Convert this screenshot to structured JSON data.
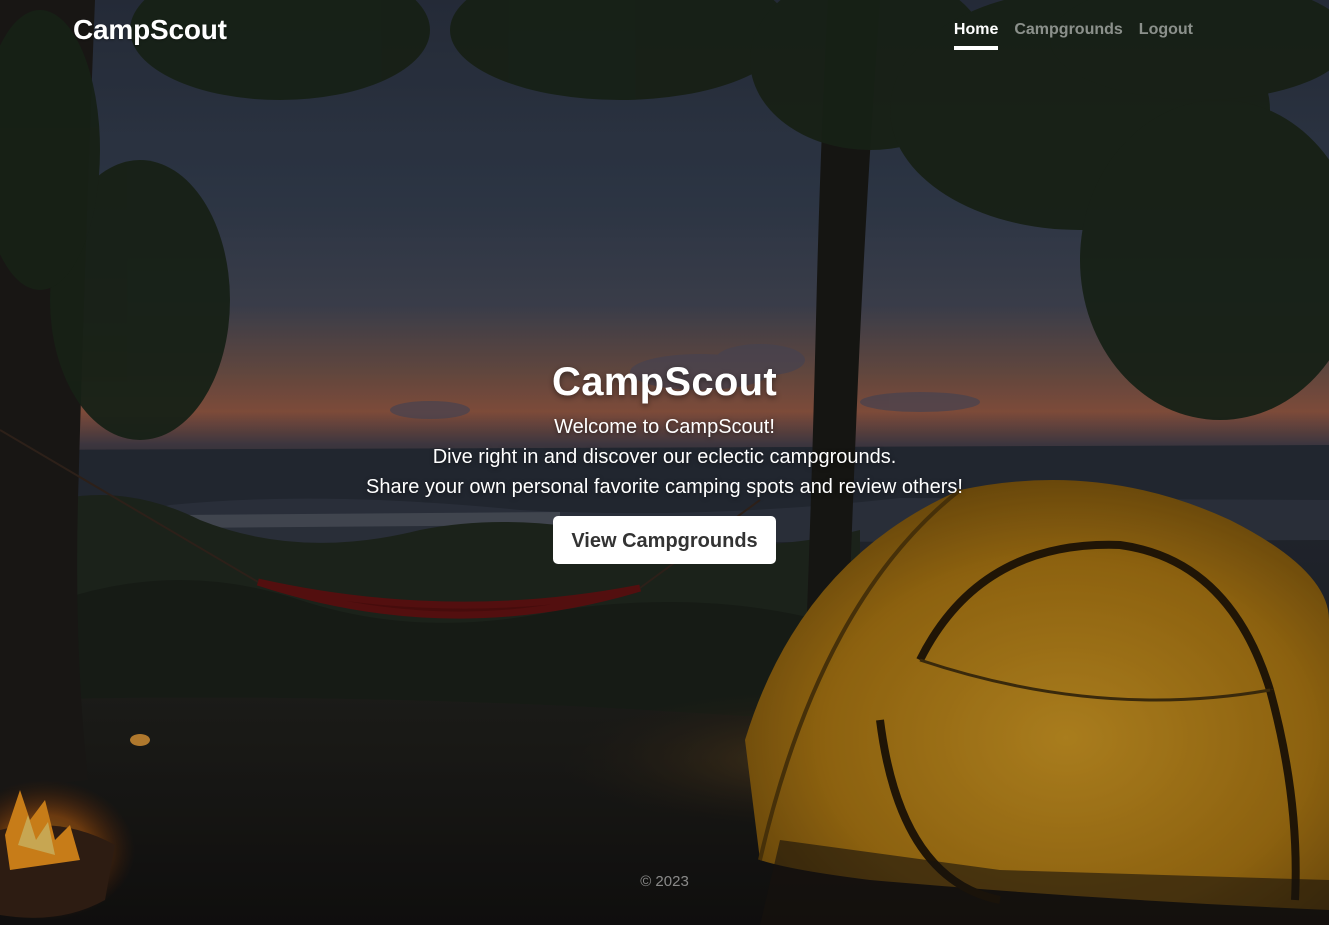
{
  "header": {
    "brand": "CampScout",
    "nav": [
      {
        "label": "Home",
        "active": true
      },
      {
        "label": "Campgrounds",
        "active": false
      },
      {
        "label": "Logout",
        "active": false
      }
    ]
  },
  "main": {
    "title": "CampScout",
    "lines": [
      "Welcome to CampScout!",
      "Dive right in and discover our eclectic campgrounds.",
      "Share your own personal favorite camping spots and review others!"
    ],
    "cta_label": "View Campgrounds"
  },
  "footer": {
    "text": "© 2023"
  },
  "colors": {
    "nav_active": "#ffffff",
    "nav_inactive": "rgba(255,255,255,0.5)",
    "button_bg": "#ffffff",
    "button_text": "#333333",
    "tent": "#c8901a"
  }
}
